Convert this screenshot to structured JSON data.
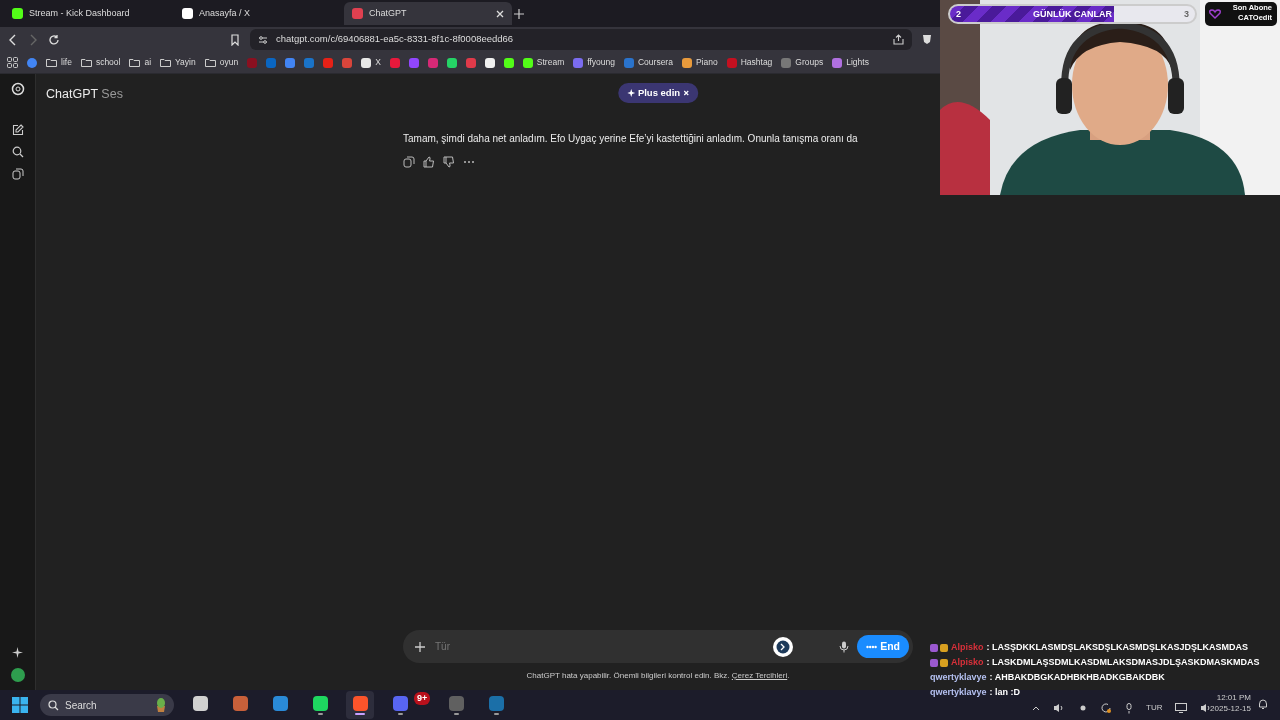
{
  "tabs": [
    {
      "title": "Stream - Kick Dashboard",
      "selected": false,
      "color": "#53fc18"
    },
    {
      "title": "Anasayfa / X",
      "selected": false,
      "color": "#ffffff"
    },
    {
      "title": "ChatGPT",
      "selected": true,
      "color": "#e04050"
    }
  ],
  "address": "chatgpt.com/c/69406881-ea5c-8331-8f1c-8f0008eedd66",
  "bookmarks": [
    {
      "kind": "folder",
      "label": "life"
    },
    {
      "kind": "folder",
      "label": "school"
    },
    {
      "kind": "folder",
      "label": "ai"
    },
    {
      "kind": "folder",
      "label": "Yayin"
    },
    {
      "kind": "folder",
      "label": "oyun"
    },
    {
      "kind": "site",
      "color": "#8a1020"
    },
    {
      "kind": "site",
      "color": "#0a66c2"
    },
    {
      "kind": "site",
      "color": "#4285f4"
    },
    {
      "kind": "site",
      "color": "#1a73c8"
    },
    {
      "kind": "site",
      "color": "#e62117"
    },
    {
      "kind": "site",
      "color": "#d9453b"
    },
    {
      "kind": "site",
      "color": "#e8e8e8",
      "label": "X"
    },
    {
      "kind": "site",
      "color": "#e8193c"
    },
    {
      "kind": "site",
      "color": "#9146ff"
    },
    {
      "kind": "site",
      "color": "#d62976"
    },
    {
      "kind": "site",
      "color": "#25d366"
    },
    {
      "kind": "site",
      "color": "#e03a4a"
    },
    {
      "kind": "site",
      "color": "#f0f0f0"
    },
    {
      "kind": "site",
      "color": "#53fc18"
    },
    {
      "kind": "site",
      "color": "#53fc18",
      "label": "Stream"
    },
    {
      "kind": "site",
      "color": "#7b6cf0",
      "label": "ffyoung"
    },
    {
      "kind": "site",
      "color": "#2a73cc",
      "label": "Coursera"
    },
    {
      "kind": "site",
      "color": "#e89a3c",
      "label": "Piano"
    },
    {
      "kind": "site",
      "color": "#c41020",
      "label": "Hashtag"
    },
    {
      "kind": "site",
      "color": "#777777",
      "label": "Groups"
    },
    {
      "kind": "site",
      "color": "#b070e0",
      "label": "Lights"
    }
  ],
  "header": {
    "title": "ChatGPT",
    "mode": "Ses",
    "upgrade": "Plus edin"
  },
  "message": "Tamam, şimdi daha net anladım. Efo Uygaç yerine Efe’yi kastettiğini anladım. Onunla tanışma oranı da",
  "composer": {
    "placeholder": "Tür",
    "end_button": "End"
  },
  "disclaimer": {
    "text": "ChatGPT hata yapabilir. Önemli bilgileri kontrol edin. Bkz.",
    "link": "Çerez Tercihleri",
    "tail": "."
  },
  "overlay": {
    "goal": {
      "title": "GÜNLÜK CANLAR",
      "start": "2",
      "end": "3",
      "level": 0.67
    },
    "last_sub": {
      "label": "Son Abone",
      "name": "CATOedit"
    }
  },
  "chat": [
    {
      "user": "Alpisko",
      "color": "#d8303a",
      "badges": true,
      "text": ": LASŞDKKLASMDŞLAKSDŞLKASMDŞLKASJDŞLKASMDAS"
    },
    {
      "user": "Alpisko",
      "color": "#d8303a",
      "badges": true,
      "text": ": LASKDMLAŞSDMLKASDMLAKSDMASJDLŞASKDMASKMDAS"
    },
    {
      "user": "qwertyklavye",
      "color": "#b4c0f0",
      "badges": false,
      "text": ": AHBAKDBGKADHBKHBADKGBAKDBK"
    },
    {
      "user": "qwertyklavye",
      "color": "#b4c0f0",
      "badges": false,
      "text": ": lan :D"
    }
  ],
  "taskbar": {
    "search": "Search",
    "apps": [
      {
        "color": "#d0d0d0",
        "selected": false,
        "running": false
      },
      {
        "color": "#c8603a",
        "selected": false,
        "running": false
      },
      {
        "color": "#2a8ad8",
        "selected": false,
        "running": false
      },
      {
        "color": "#1ed760",
        "selected": false,
        "running": true
      },
      {
        "color": "#fb542b",
        "selected": true,
        "running": true
      },
      {
        "color": "#5865f2",
        "selected": false,
        "running": true,
        "badge": "9+"
      },
      {
        "color": "#606060",
        "selected": false,
        "running": true
      },
      {
        "color": "#1b6fa8",
        "selected": false,
        "running": true
      }
    ],
    "language": "TUR",
    "time": "12:01 PM",
    "date": "2025-12-15"
  }
}
